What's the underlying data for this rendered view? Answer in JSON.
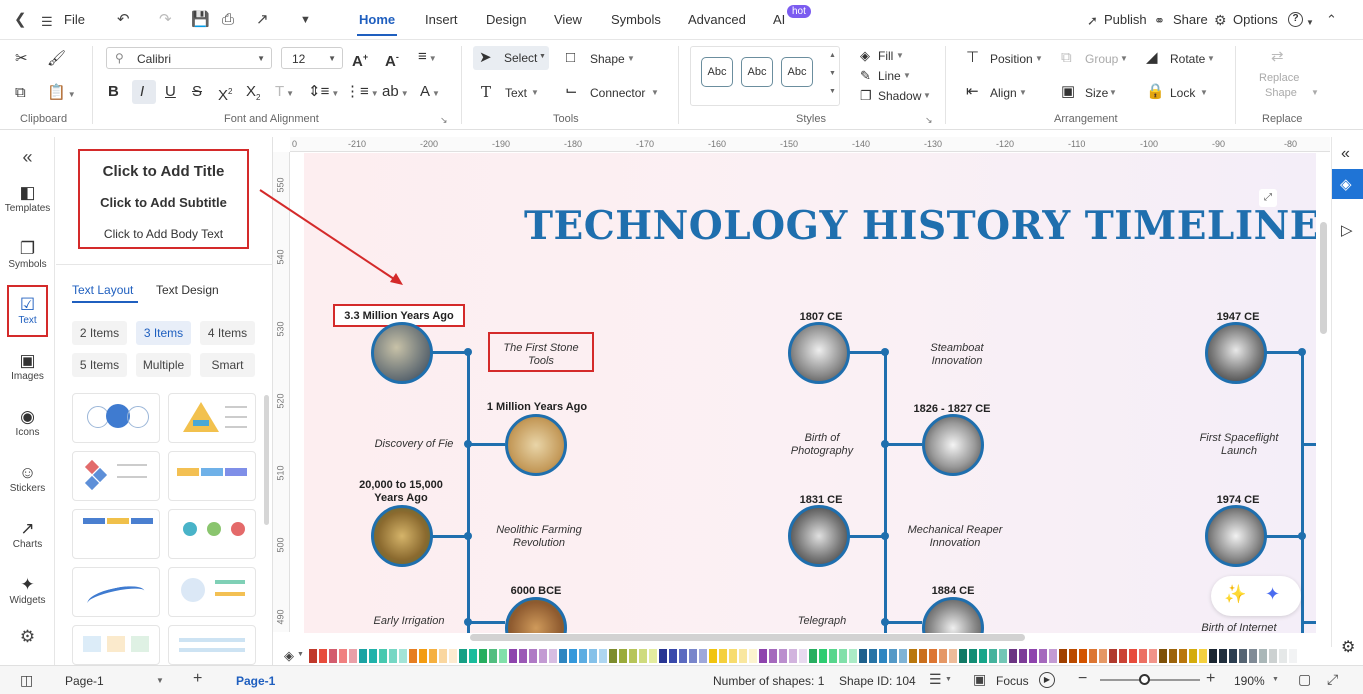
{
  "topbar": {
    "file": "File",
    "tabs": [
      "Home",
      "Insert",
      "Design",
      "View",
      "Symbols",
      "Advanced",
      "AI"
    ],
    "active_tab": "Home",
    "ai_badge": "hot",
    "publish": "Publish",
    "share": "Share",
    "options": "Options",
    "help": "?"
  },
  "ribbon": {
    "font_name": "Calibri",
    "font_size": "12",
    "groups": {
      "clipboard": "Clipboard",
      "font": "Font and Alignment",
      "tools": "Tools",
      "styles": "Styles",
      "arrangement": "Arrangement",
      "replace": "Replace"
    },
    "select": "Select",
    "shape": "Shape",
    "text": "Text",
    "connector": "Connector",
    "style_sample": "Abc",
    "fill": "Fill",
    "line": "Line",
    "shadow": "Shadow",
    "position": "Position",
    "group": "Group",
    "rotate": "Rotate",
    "align": "Align",
    "size": "Size",
    "lock": "Lock",
    "replace_shape_1": "Replace",
    "replace_shape_2": "Shape"
  },
  "leftrail": {
    "items": [
      "Templates",
      "Symbols",
      "Text",
      "Images",
      "Icons",
      "Stickers",
      "Charts",
      "Widgets"
    ],
    "active": "Text"
  },
  "panel": {
    "preview_title": "Click to Add Title",
    "preview_subtitle": "Click to Add Subtitle",
    "preview_body": "Click to Add Body Text",
    "tabs": [
      "Text Layout",
      "Text Design"
    ],
    "active_tab": "Text Layout",
    "pills": [
      "2 Items",
      "3 Items",
      "4 Items",
      "5 Items",
      "Multiple",
      "Smart"
    ],
    "active_pill": "3 Items"
  },
  "ruler": {
    "h": [
      "0",
      "-210",
      "-200",
      "-190",
      "-180",
      "-170",
      "-160",
      "-150",
      "-140",
      "-130",
      "-120",
      "-110",
      "-100",
      "-90",
      "-80"
    ],
    "v": [
      "550",
      "540",
      "530",
      "520",
      "510",
      "500",
      "490"
    ]
  },
  "canvas": {
    "title": "TECHNOLOGY HISTORY TIMELINE",
    "col1": {
      "label1": "3.3 Million Years Ago",
      "note1": "The First Stone Tools",
      "label2": "1 Million Years Ago",
      "note2": "Discovery of Fie",
      "label3a": "20,000 to 15,000",
      "label3b": "Years Ago",
      "note3": "Neolithic Farming Revolution",
      "label4": "6000 BCE",
      "note4": "Early Irrigation"
    },
    "col2": {
      "label1": "1807 CE",
      "note1": "Steamboat Innovation",
      "label2": "1826 - 1827 CE",
      "note2": "Birth of Photography",
      "label3": "1831 CE",
      "note3": "Mechanical Reaper Innovation",
      "label4": "1884 CE",
      "note4": "Telegraph"
    },
    "col3": {
      "label1": "1947 CE",
      "note2": "First Spaceflight Launch",
      "label3": "1974 CE",
      "note4": "Birth of Internet"
    }
  },
  "statusbar": {
    "page_select": "Page-1",
    "page_tab": "Page-1",
    "shapes": "Number of shapes: 1",
    "shape_id": "Shape ID: 104",
    "focus": "Focus",
    "zoom": "190%"
  },
  "palette": [
    "#c0392b",
    "#e74c3c",
    "#d35d6e",
    "#f08080",
    "#e9a0a8",
    "#1aa3a3",
    "#20b2aa",
    "#48c9b0",
    "#76d7c4",
    "#a3e4d7",
    "#e67e22",
    "#f39c12",
    "#f5b041",
    "#fad7a0",
    "#fdebd0",
    "#16a085",
    "#1abc9c",
    "#27ae60",
    "#52be80",
    "#82e0aa",
    "#8e44ad",
    "#9b59b6",
    "#af7ac5",
    "#c39bd3",
    "#d7bde2",
    "#2e86c1",
    "#3498db",
    "#5dade2",
    "#85c1e9",
    "#aed6f1",
    "#7d8c2d",
    "#9aab3b",
    "#b7c55a",
    "#cfdb7e",
    "#e3ec9f",
    "#283593",
    "#3949ab",
    "#5c6bc0",
    "#7986cb",
    "#9fa8da",
    "#f1c40f",
    "#f4d03f",
    "#f7dc6f",
    "#f9e79f",
    "#fcf3cf",
    "#8e44ad",
    "#a569bd",
    "#bb8fce",
    "#d2b4de",
    "#e8daef",
    "#27ae60",
    "#2ecc71",
    "#58d68d",
    "#82e0aa",
    "#abebc6",
    "#1f618d",
    "#2874a6",
    "#2e86c1",
    "#5499c7",
    "#7fb3d5",
    "#b9770e",
    "#ca6f1e",
    "#dc7633",
    "#e59866",
    "#edbb99",
    "#117a65",
    "#138d75",
    "#17a589",
    "#45b39d",
    "#73c6b6",
    "#6c3483",
    "#7d3c98",
    "#8e44ad",
    "#a569bd",
    "#c39bd3",
    "#a04000",
    "#ba4a00",
    "#d35400",
    "#dc7633",
    "#e59866",
    "#b03a2e",
    "#cb4335",
    "#e74c3c",
    "#ec7063",
    "#f1948a",
    "#7e5109",
    "#9c640c",
    "#b9770e",
    "#d4ac0d",
    "#f4d03f",
    "#1b2631",
    "#212f3d",
    "#2c3e50",
    "#566573",
    "#808b96",
    "#aab7b8",
    "#ccd1d1",
    "#e5e8e8",
    "#f2f3f4"
  ]
}
